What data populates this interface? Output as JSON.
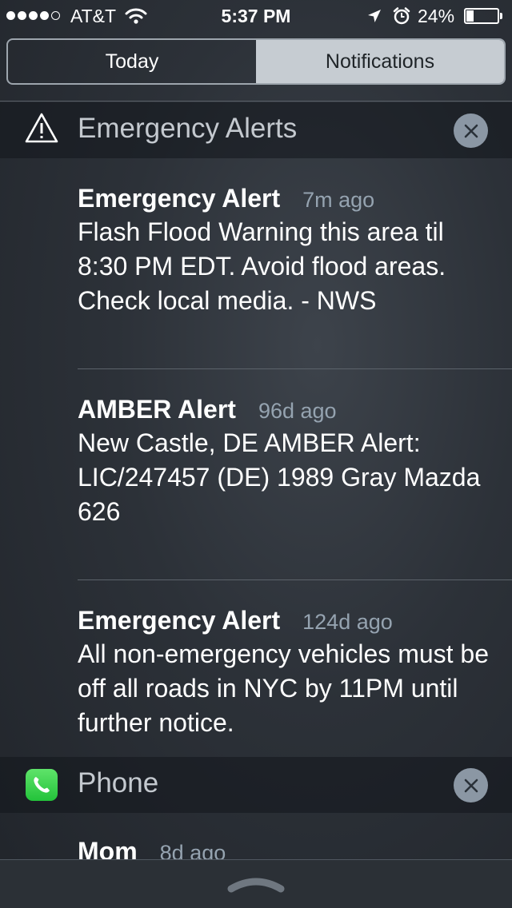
{
  "status_bar": {
    "carrier": "AT&T",
    "time": "5:37 PM",
    "battery_percent": "24%",
    "battery_level": 0.24,
    "signal_bars": 4,
    "signal_max": 5,
    "icons": [
      "signal-dots-icon",
      "wifi-icon",
      "location-arrow-icon",
      "alarm-clock-icon",
      "battery-icon"
    ]
  },
  "tabs": [
    {
      "label": "Today",
      "selected": false
    },
    {
      "label": "Notifications",
      "selected": true
    }
  ],
  "sections": [
    {
      "name": "Emergency Alerts",
      "icon": "warning-triangle-icon",
      "notifications": [
        {
          "title": "Emergency Alert",
          "time": "7m ago",
          "body": "Flash Flood Warning this area til 8:30 PM EDT. Avoid flood areas. Check local media. - NWS"
        },
        {
          "title": "AMBER Alert",
          "time": "96d ago",
          "body": "New Castle, DE AMBER Alert: LIC/247457 (DE) 1989 Gray Mazda 626"
        },
        {
          "title": "Emergency Alert",
          "time": "124d ago",
          "body": "All non-emergency vehicles must be off all roads in NYC by 11PM until further notice."
        }
      ]
    },
    {
      "name": "Phone",
      "icon": "phone-app-icon",
      "notifications": [
        {
          "title": "Mom",
          "time": "8d ago"
        }
      ]
    }
  ],
  "colors": {
    "selected_tab_bg": "#c6ccd2",
    "timestamp": "#95a3b0",
    "close_button": "#8b97a4",
    "phone_green": "#34c84a"
  }
}
